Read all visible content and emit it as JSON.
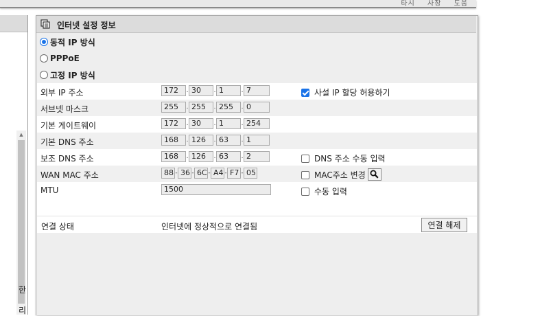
{
  "top_links": [
    "타시",
    "사장",
    "도움"
  ],
  "left_fragments": [
    "한",
    "리"
  ],
  "panel": {
    "title": "인터넷 설정 정보",
    "connection_types": [
      {
        "label": "동적 IP 방식",
        "selected": true
      },
      {
        "label": "PPPoE",
        "selected": false
      },
      {
        "label": "고정 IP 방식",
        "selected": false
      }
    ]
  },
  "fields": {
    "external_ip": {
      "label": "외부 IP 주소",
      "octets": [
        "172",
        "30",
        "1",
        "7"
      ],
      "option_label": "사설 IP 할당 허용하기",
      "option_checked": true
    },
    "subnet": {
      "label": "서브넷 마스크",
      "octets": [
        "255",
        "255",
        "255",
        "0"
      ]
    },
    "gateway": {
      "label": "기본 게이트웨이",
      "octets": [
        "172",
        "30",
        "1",
        "254"
      ]
    },
    "dns_primary": {
      "label": "기본 DNS 주소",
      "octets": [
        "168",
        "126",
        "63",
        "1"
      ]
    },
    "dns_secondary": {
      "label": "보조 DNS 주소",
      "octets": [
        "168",
        "126",
        "63",
        "2"
      ],
      "option_label": "DNS 주소 수동 입력",
      "option_checked": false
    },
    "wan_mac": {
      "label": "WAN MAC 주소",
      "octets": [
        "88",
        "36",
        "6C",
        "A4",
        "F7",
        "05"
      ],
      "option_label": "MAC주소 변경",
      "option_checked": false
    },
    "mtu": {
      "label": "MTU",
      "value": "1500",
      "option_label": "수동 입력",
      "option_checked": false
    }
  },
  "status": {
    "label": "연결 상태",
    "value": "인터넷에 정상적으로 연결됨",
    "button_label": "연결 해제"
  },
  "colors": {
    "accent": "#1a73e8",
    "panel_bg": "#eeeeee",
    "title_bg": "#dcdcdc"
  },
  "icons": {
    "title": "window-copy-icon",
    "mac_search": "search-icon"
  }
}
